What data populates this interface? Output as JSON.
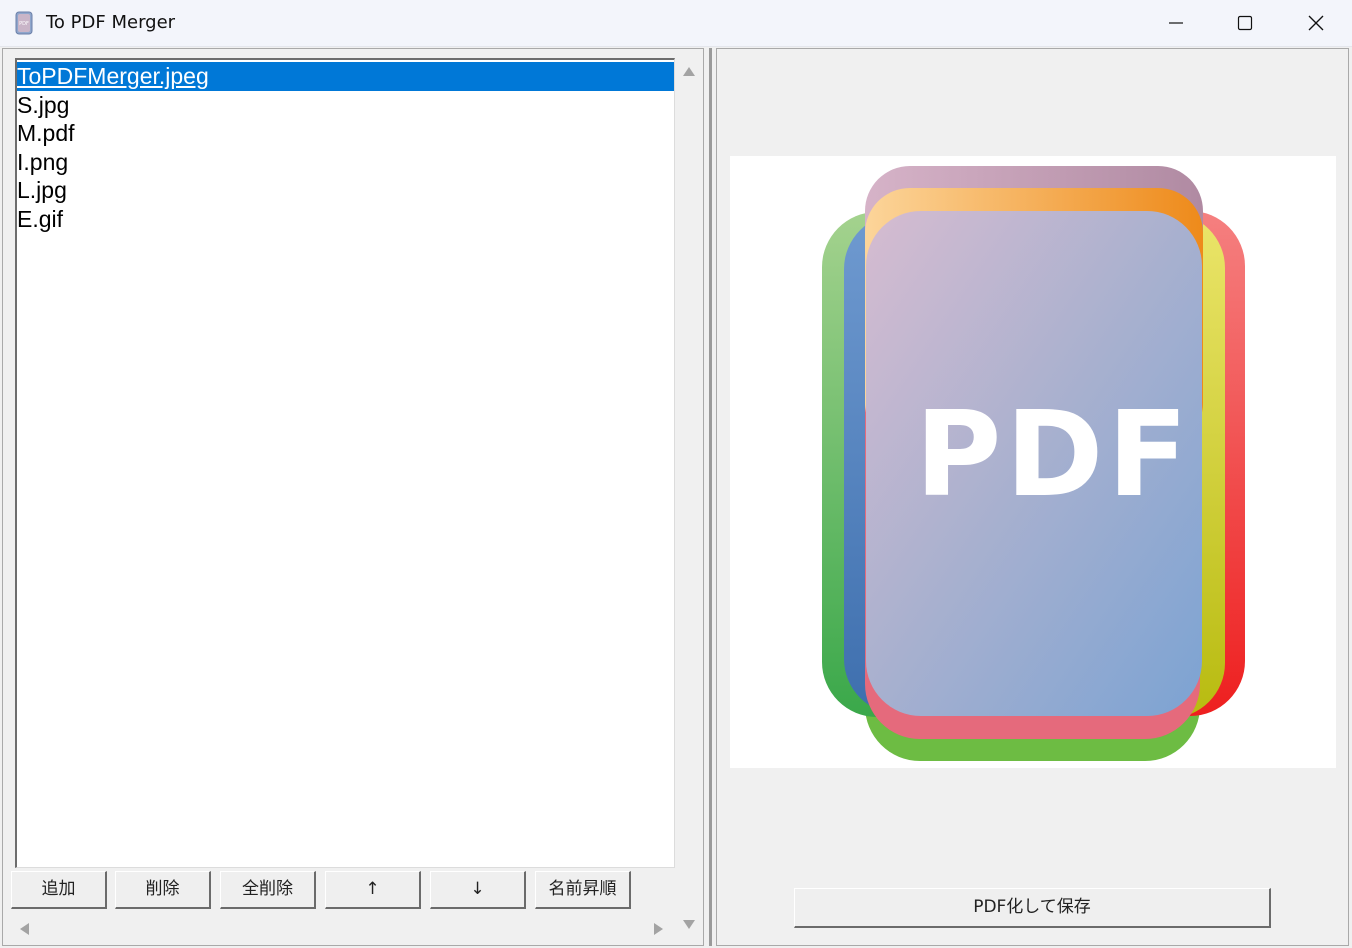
{
  "window": {
    "title": "To PDF Merger",
    "controls": [
      "minimize-icon",
      "maximize-icon",
      "close-icon"
    ]
  },
  "file_list": {
    "items": [
      {
        "name": "ToPDFMerger.jpeg",
        "selected": true
      },
      {
        "name": "S.jpg",
        "selected": false
      },
      {
        "name": "M.pdf",
        "selected": false
      },
      {
        "name": "I.png",
        "selected": false
      },
      {
        "name": "L.jpg",
        "selected": false
      },
      {
        "name": "E.gif",
        "selected": false
      }
    ]
  },
  "buttons": {
    "add": "追加",
    "delete": "削除",
    "delete_all": "全削除",
    "move_up": "↑",
    "move_down": "↓",
    "sort_by_name": "名前昇順"
  },
  "preview": {
    "image_text": "PDF"
  },
  "save_button": "PDF化して保存",
  "colors": {
    "selection": "#0078d7",
    "window_bg": "#f0f0f0",
    "titlebar_bg": "#f3f5fb"
  }
}
